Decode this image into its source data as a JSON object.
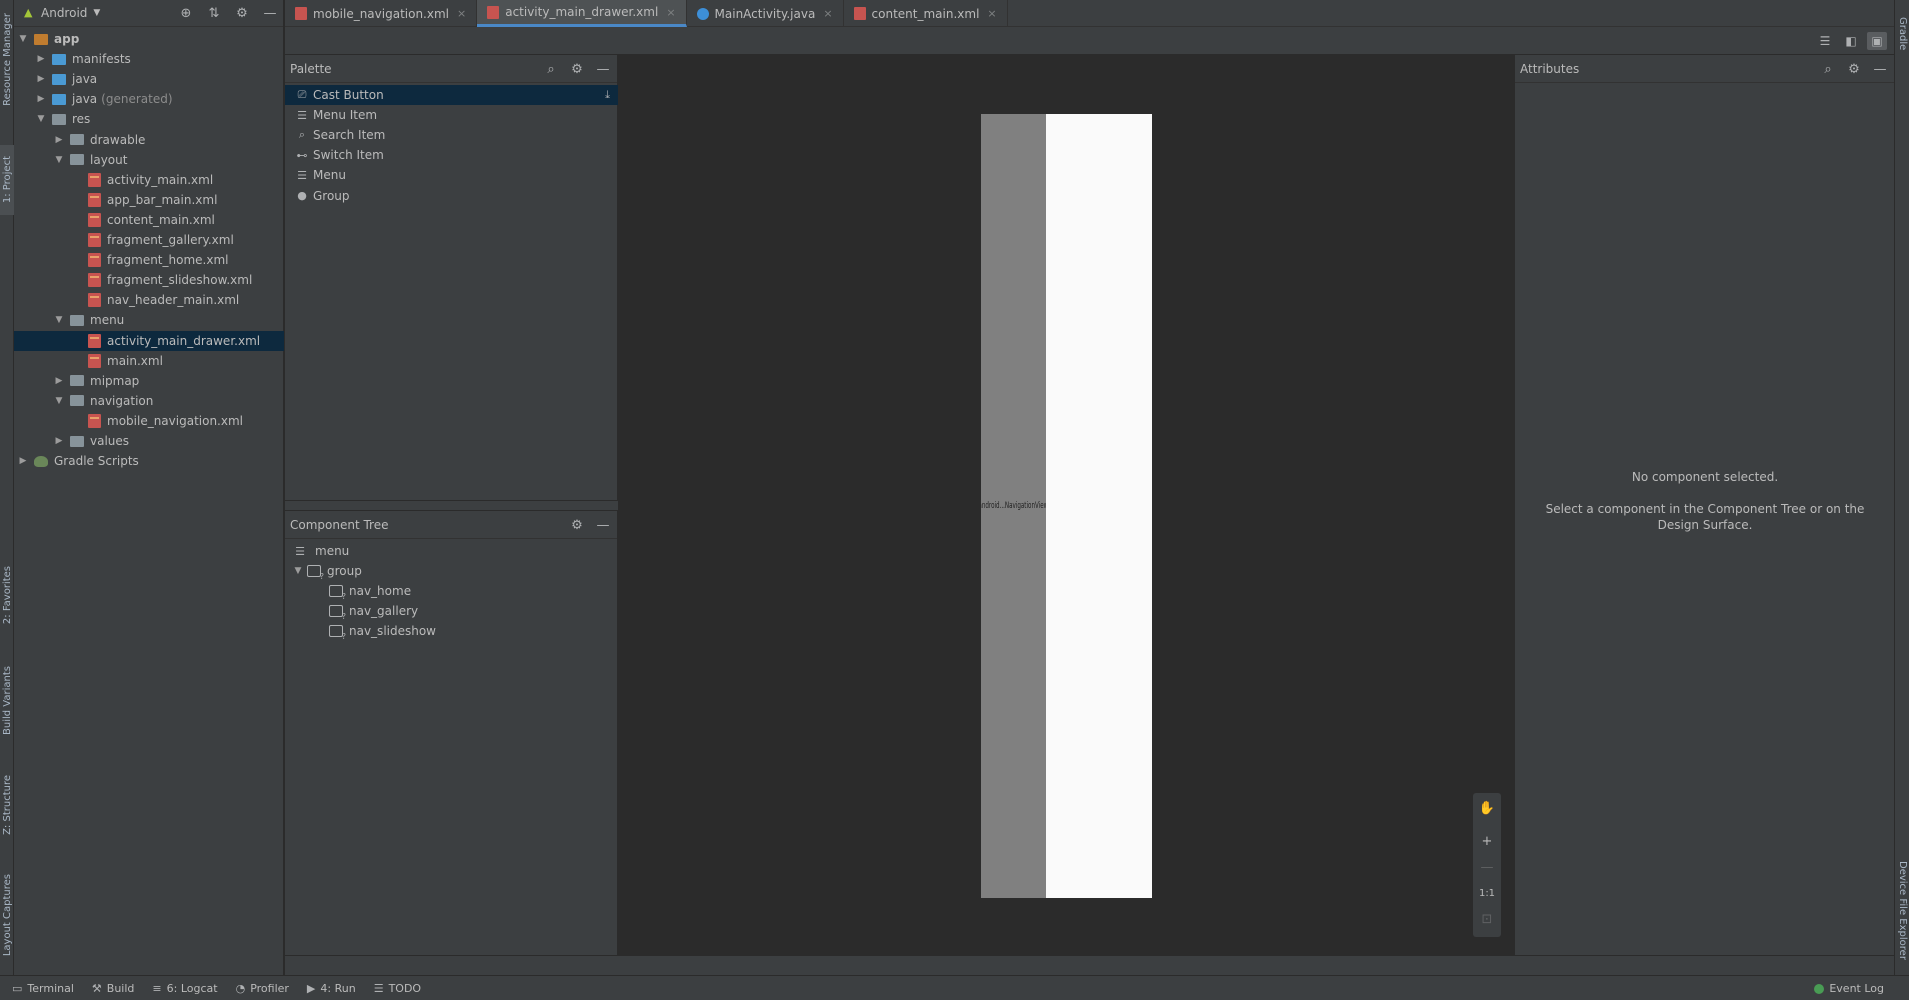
{
  "project": {
    "view_selector": "Android",
    "tree": [
      {
        "label": "app",
        "depth": 0,
        "expanded": true,
        "kind": "module"
      },
      {
        "label": "manifests",
        "depth": 1,
        "expanded": false,
        "kind": "folder-blue"
      },
      {
        "label": "java",
        "depth": 1,
        "expanded": false,
        "kind": "folder-blue"
      },
      {
        "label": "java",
        "suffix": "(generated)",
        "depth": 1,
        "expanded": false,
        "kind": "folder-blue"
      },
      {
        "label": "res",
        "depth": 1,
        "expanded": true,
        "kind": "folder"
      },
      {
        "label": "drawable",
        "depth": 2,
        "expanded": false,
        "kind": "folder"
      },
      {
        "label": "layout",
        "depth": 2,
        "expanded": true,
        "kind": "folder"
      },
      {
        "label": "activity_main.xml",
        "depth": 3,
        "kind": "xml"
      },
      {
        "label": "app_bar_main.xml",
        "depth": 3,
        "kind": "xml"
      },
      {
        "label": "content_main.xml",
        "depth": 3,
        "kind": "xml"
      },
      {
        "label": "fragment_gallery.xml",
        "depth": 3,
        "kind": "xml"
      },
      {
        "label": "fragment_home.xml",
        "depth": 3,
        "kind": "xml"
      },
      {
        "label": "fragment_slideshow.xml",
        "depth": 3,
        "kind": "xml"
      },
      {
        "label": "nav_header_main.xml",
        "depth": 3,
        "kind": "xml"
      },
      {
        "label": "menu",
        "depth": 2,
        "expanded": true,
        "kind": "folder"
      },
      {
        "label": "activity_main_drawer.xml",
        "depth": 3,
        "kind": "xml",
        "selected": true
      },
      {
        "label": "main.xml",
        "depth": 3,
        "kind": "xml"
      },
      {
        "label": "mipmap",
        "depth": 2,
        "expanded": false,
        "kind": "folder"
      },
      {
        "label": "navigation",
        "depth": 2,
        "expanded": true,
        "kind": "folder"
      },
      {
        "label": "mobile_navigation.xml",
        "depth": 3,
        "kind": "xml"
      },
      {
        "label": "values",
        "depth": 2,
        "expanded": false,
        "kind": "folder"
      },
      {
        "label": "Gradle Scripts",
        "depth": 0,
        "expanded": false,
        "kind": "gradle"
      }
    ]
  },
  "tabs": [
    {
      "label": "mobile_navigation.xml",
      "icon": "xml-file-icon",
      "active": false
    },
    {
      "label": "activity_main_drawer.xml",
      "icon": "xml-file-icon",
      "active": true
    },
    {
      "label": "MainActivity.java",
      "icon": "java-class-icon",
      "active": false
    },
    {
      "label": "content_main.xml",
      "icon": "xml-file-icon",
      "active": false
    }
  ],
  "palette": {
    "title": "Palette",
    "items": [
      {
        "label": "Cast Button",
        "icon": "cast-icon",
        "selected": true
      },
      {
        "label": "Menu Item",
        "icon": "list-icon"
      },
      {
        "label": "Search Item",
        "icon": "search-icon"
      },
      {
        "label": "Switch Item",
        "icon": "switch-icon"
      },
      {
        "label": "Menu",
        "icon": "menu-icon"
      },
      {
        "label": "Group",
        "icon": "group-icon"
      }
    ]
  },
  "component_tree": {
    "title": "Component Tree",
    "nodes": [
      {
        "label": "menu",
        "depth": 0,
        "icon": "menu-icon"
      },
      {
        "label": "group",
        "depth": 0,
        "icon": "group-icon",
        "expanded": true
      },
      {
        "label": "nav_home",
        "depth": 1,
        "icon": "menu-item-icon"
      },
      {
        "label": "nav_gallery",
        "depth": 1,
        "icon": "menu-item-icon"
      },
      {
        "label": "nav_slideshow",
        "depth": 1,
        "icon": "menu-item-icon"
      }
    ]
  },
  "design": {
    "navigation_view_label": "android...NavigationView"
  },
  "zoom": {
    "reset_label": "1:1"
  },
  "attributes": {
    "title": "Attributes",
    "no_selection": "No component selected.",
    "hint_line1": "Select a component in the Component Tree or on the",
    "hint_line2": "Design Surface."
  },
  "side_tabs": {
    "left": [
      "Resource Manager",
      "1: Project",
      "2: Favorites",
      "Build Variants",
      "Z: Structure",
      "Layout Captures"
    ],
    "right": [
      "Gradle",
      "Device File Explorer"
    ]
  },
  "status_bar": {
    "items": [
      {
        "label": "Terminal",
        "icon": "terminal-icon"
      },
      {
        "label": "Build",
        "icon": "hammer-icon"
      },
      {
        "label": "6: Logcat",
        "icon": "logcat-icon"
      },
      {
        "label": "Profiler",
        "icon": "profiler-icon"
      },
      {
        "label": "4: Run",
        "icon": "run-icon"
      },
      {
        "label": "TODO",
        "icon": "todo-icon"
      }
    ],
    "event_log": "Event Log"
  },
  "colors": {
    "selection": "#0d293e",
    "panel": "#3c3f41",
    "editor": "#2b2b2b",
    "accent": "#4a88c7"
  }
}
